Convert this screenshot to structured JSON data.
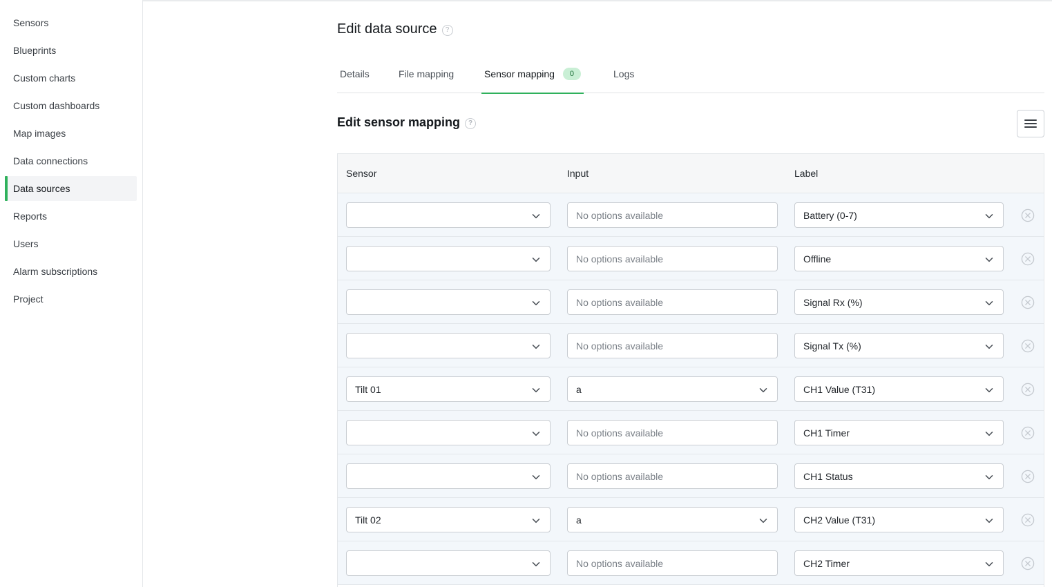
{
  "sidebar": {
    "items": [
      {
        "label": "Sensors"
      },
      {
        "label": "Blueprints"
      },
      {
        "label": "Custom charts"
      },
      {
        "label": "Custom dashboards"
      },
      {
        "label": "Map images"
      },
      {
        "label": "Data connections"
      },
      {
        "label": "Data sources",
        "active": true
      },
      {
        "label": "Reports"
      },
      {
        "label": "Users"
      },
      {
        "label": "Alarm subscriptions"
      },
      {
        "label": "Project"
      }
    ]
  },
  "page": {
    "title": "Edit data source",
    "help_glyph": "?"
  },
  "tabs": [
    {
      "label": "Details"
    },
    {
      "label": "File mapping"
    },
    {
      "label": "Sensor mapping",
      "badge": "0",
      "active": true
    },
    {
      "label": "Logs"
    }
  ],
  "section": {
    "title": "Edit sensor mapping",
    "menu_icon": "hamburger-menu-icon"
  },
  "table": {
    "headers": {
      "sensor": "Sensor",
      "input": "Input",
      "label": "Label"
    },
    "rows": [
      {
        "sensor": "",
        "input": "No options available",
        "input_empty": true,
        "label": "Battery (0-7)"
      },
      {
        "sensor": "",
        "input": "No options available",
        "input_empty": true,
        "label": "Offline"
      },
      {
        "sensor": "",
        "input": "No options available",
        "input_empty": true,
        "label": "Signal Rx (%)"
      },
      {
        "sensor": "",
        "input": "No options available",
        "input_empty": true,
        "label": "Signal Tx (%)"
      },
      {
        "sensor": "Tilt 01",
        "input": "a",
        "input_empty": false,
        "label": "CH1 Value (T31)"
      },
      {
        "sensor": "",
        "input": "No options available",
        "input_empty": true,
        "label": "CH1 Timer"
      },
      {
        "sensor": "",
        "input": "No options available",
        "input_empty": true,
        "label": "CH1 Status"
      },
      {
        "sensor": "Tilt 02",
        "input": "a",
        "input_empty": false,
        "label": "CH2 Value (T31)"
      },
      {
        "sensor": "",
        "input": "No options available",
        "input_empty": true,
        "label": "CH2 Timer"
      }
    ]
  },
  "colors": {
    "accent": "#2fb15c",
    "badge_bg": "#c9efd5",
    "row_bg": "#f3f7fb",
    "header_bg": "#f6f7f8"
  }
}
